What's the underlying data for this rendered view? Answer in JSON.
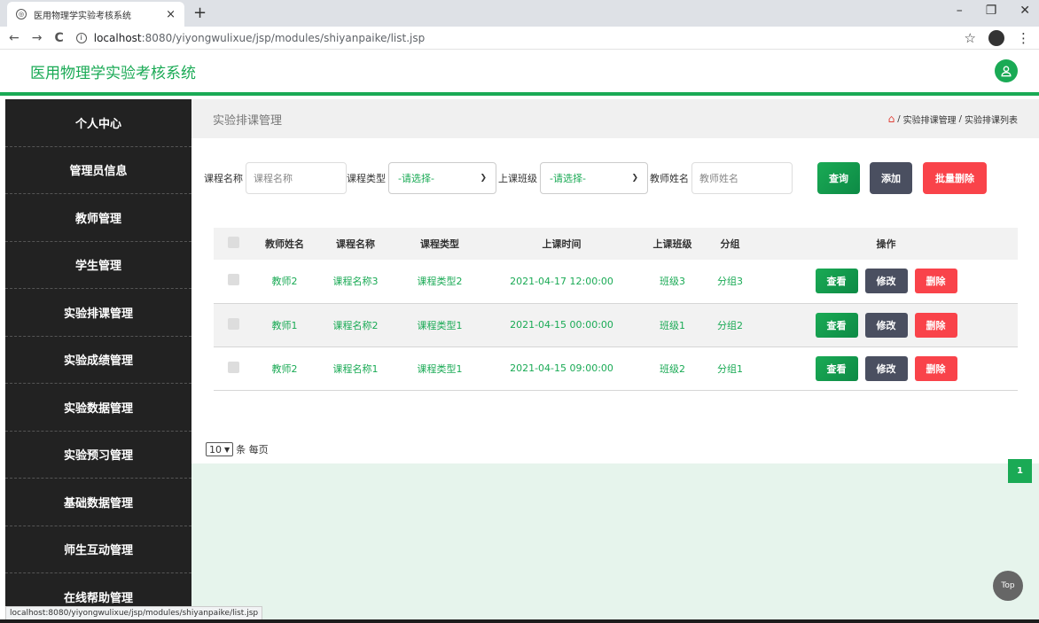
{
  "browser": {
    "tab_title": "医用物理学实验考核系统",
    "tab_close": "×",
    "new_tab": "+",
    "win_min": "–",
    "win_max": "❐",
    "win_close": "✕",
    "back": "←",
    "forward": "→",
    "reload": "C",
    "url_host": "localhost",
    "url_path": ":8080/yiyongwulixue/jsp/modules/shiyanpaike/list.jsp",
    "star": "☆",
    "menu": "⋮",
    "status_url": "localhost:8080/yiyongwulixue/jsp/modules/shiyanpaike/list.jsp"
  },
  "app": {
    "title": "医用物理学实验考核系统",
    "accent_color": "#1aaa55"
  },
  "sidebar": {
    "items": [
      {
        "label": "个人中心"
      },
      {
        "label": "管理员信息"
      },
      {
        "label": "教师管理"
      },
      {
        "label": "学生管理"
      },
      {
        "label": "实验排课管理"
      },
      {
        "label": "实验成绩管理"
      },
      {
        "label": "实验数据管理"
      },
      {
        "label": "实验预习管理"
      },
      {
        "label": "基础数据管理"
      },
      {
        "label": "师生互动管理"
      },
      {
        "label": "在线帮助管理"
      }
    ]
  },
  "page": {
    "title": "实验排课管理",
    "crumb_sep": "/",
    "crumb_1": "实验排课管理",
    "crumb_2": "实验排课列表"
  },
  "filters": {
    "course_name_label": "课程名称",
    "course_name_placeholder": "课程名称",
    "course_type_label": "课程类型",
    "course_type_value": "-请选择-",
    "class_label": "上课班级",
    "class_value": "-请选择-",
    "teacher_label": "教师姓名",
    "teacher_placeholder": "教师姓名",
    "search_label": "查询",
    "add_label": "添加",
    "batch_delete_label": "批量删除"
  },
  "table": {
    "headers": [
      "教师姓名",
      "课程名称",
      "课程类型",
      "上课时间",
      "上课班级",
      "分组",
      "操作"
    ],
    "rows": [
      {
        "teacher": "教师2",
        "course": "课程名称3",
        "type": "课程类型2",
        "time": "2021-04-17 12:00:00",
        "class": "班级3",
        "group": "分组3"
      },
      {
        "teacher": "教师1",
        "course": "课程名称2",
        "type": "课程类型1",
        "time": "2021-04-15 00:00:00",
        "class": "班级1",
        "group": "分组2"
      },
      {
        "teacher": "教师2",
        "course": "课程名称1",
        "type": "课程类型1",
        "time": "2021-04-15 09:00:00",
        "class": "班级2",
        "group": "分组1"
      }
    ],
    "view_label": "查看",
    "edit_label": "修改",
    "delete_label": "删除"
  },
  "pagination": {
    "page_size": "10",
    "per_page_label": "条 每页",
    "current_page": "1"
  },
  "top_button": "Top"
}
